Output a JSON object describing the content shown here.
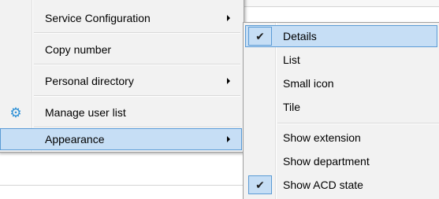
{
  "main_menu": {
    "items": [
      {
        "label": "Service Configuration",
        "has_submenu": true
      },
      {
        "label": "Copy number",
        "has_submenu": false
      },
      {
        "label": "Personal directory",
        "has_submenu": true
      },
      {
        "label": "Manage user list",
        "has_submenu": false,
        "icon": "gear-icon"
      },
      {
        "label": "Appearance",
        "has_submenu": true,
        "highlighted": true
      }
    ]
  },
  "appearance_submenu": {
    "view_items": [
      {
        "label": "Details",
        "checked": true,
        "highlighted": true
      },
      {
        "label": "List",
        "checked": false
      },
      {
        "label": "Small icon",
        "checked": false
      },
      {
        "label": "Tile",
        "checked": false
      }
    ],
    "show_items": [
      {
        "label": "Show extension",
        "checked": false
      },
      {
        "label": "Show department",
        "checked": false
      },
      {
        "label": "Show ACD state",
        "checked": true
      }
    ],
    "check_glyph": "✔"
  },
  "colors": {
    "highlight_fill": "#c6def5",
    "highlight_border": "#5b9bd5",
    "menu_background": "#f2f2f2",
    "gear_icon": "#2b8fd6"
  }
}
